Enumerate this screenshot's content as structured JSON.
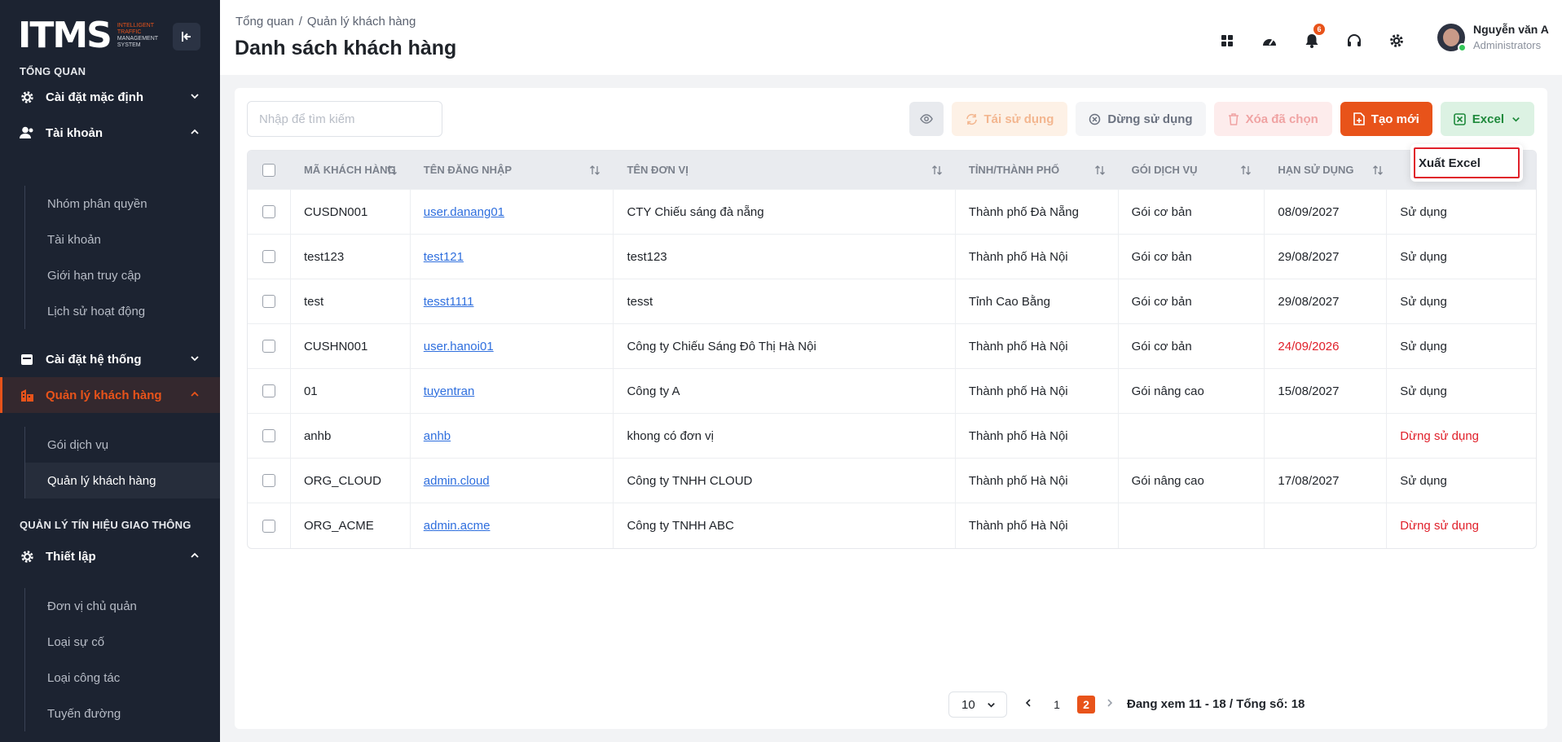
{
  "brand": {
    "logo": "ITMS",
    "tagline": [
      "INTELLIGENT",
      "TRAFFIC",
      "MANAGEMENT",
      "SYSTEM"
    ]
  },
  "sidebar": {
    "section_overview": "TỔNG QUAN",
    "default_settings": "Cài đặt mặc định",
    "account": "Tài khoản",
    "account_items": [
      "Nhóm phân quyền",
      "Tài khoản",
      "Giới hạn truy cập",
      "Lịch sử hoạt động"
    ],
    "system_settings": "Cài đặt hệ thống",
    "customer_mgmt": "Quản lý khách hàng",
    "customer_items": [
      "Gói dịch vụ",
      "Quản lý khách hàng"
    ],
    "section_traffic": "QUẢN LÝ TÍN HIỆU GIAO THÔNG",
    "setup": "Thiết lập",
    "setup_items": [
      "Đơn vị chủ quản",
      "Loại sự cố",
      "Loại công tác",
      "Tuyến đường"
    ]
  },
  "header": {
    "breadcrumb": [
      "Tổng quan",
      "Quản lý khách hàng"
    ],
    "title": "Danh sách khách hàng",
    "notification_count": "6",
    "user_name": "Nguyễn văn A",
    "user_role": "Administrators"
  },
  "toolbar": {
    "search_placeholder": "Nhập để tìm kiếm",
    "reuse": "Tái sử dụng",
    "stop": "Dừng sử dụng",
    "delete_selected": "Xóa đã chọn",
    "create": "Tạo mới",
    "excel": "Excel",
    "export_excel": "Xuất Excel"
  },
  "table": {
    "headers": [
      "MÃ KHÁCH HÀNG",
      "TÊN ĐĂNG NHẬP",
      "TÊN ĐƠN VỊ",
      "TỈNH/THÀNH PHỐ",
      "GÓI DỊCH VỤ",
      "HẠN SỬ DỤNG"
    ],
    "rows": [
      {
        "code": "CUSDN001",
        "username": "user.danang01",
        "unit": "CTY Chiếu sáng đà nẵng",
        "city": "Thành phố Đà Nẵng",
        "plan": "Gói cơ bản",
        "expiry": "08/09/2027",
        "expiry_warn": false,
        "status": "Sử dụng",
        "status_stopped": false
      },
      {
        "code": "test123",
        "username": "test121",
        "unit": "test123",
        "city": "Thành phố Hà Nội",
        "plan": "Gói cơ bản",
        "expiry": "29/08/2027",
        "expiry_warn": false,
        "status": "Sử dụng",
        "status_stopped": false
      },
      {
        "code": "test",
        "username": "tesst1111",
        "unit": "tesst",
        "city": "Tỉnh Cao Bằng",
        "plan": "Gói cơ bản",
        "expiry": "29/08/2027",
        "expiry_warn": false,
        "status": "Sử dụng",
        "status_stopped": false
      },
      {
        "code": "CUSHN001",
        "username": "user.hanoi01",
        "unit": "Công ty Chiếu Sáng Đô Thị Hà Nội",
        "city": "Thành phố Hà Nội",
        "plan": "Gói cơ bản",
        "expiry": "24/09/2026",
        "expiry_warn": true,
        "status": "Sử dụng",
        "status_stopped": false
      },
      {
        "code": "01",
        "username": "tuyentran",
        "unit": "Công ty A",
        "city": "Thành phố Hà Nội",
        "plan": "Gói nâng cao",
        "expiry": "15/08/2027",
        "expiry_warn": false,
        "status": "Sử dụng",
        "status_stopped": false
      },
      {
        "code": "anhb",
        "username": "anhb",
        "unit": "khong có đơn vị",
        "city": "Thành phố Hà Nội",
        "plan": "",
        "expiry": "",
        "expiry_warn": false,
        "status": "Dừng sử dụng",
        "status_stopped": true
      },
      {
        "code": "ORG_CLOUD",
        "username": "admin.cloud",
        "unit": "Công ty TNHH CLOUD",
        "city": "Thành phố Hà Nội",
        "plan": "Gói nâng cao",
        "expiry": "17/08/2027",
        "expiry_warn": false,
        "status": "Sử dụng",
        "status_stopped": false
      },
      {
        "code": "ORG_ACME",
        "username": "admin.acme",
        "unit": "Công ty TNHH ABC",
        "city": "Thành phố Hà Nội",
        "plan": "",
        "expiry": "",
        "expiry_warn": false,
        "status": "Dừng sử dụng",
        "status_stopped": true
      }
    ]
  },
  "pagination": {
    "page_size": "10",
    "pages": [
      "1",
      "2"
    ],
    "current": "2",
    "info": "Đang xem 11 - 18 / Tổng số: 18"
  },
  "colors": {
    "accent": "#e8531a",
    "sidebar_bg": "#1c2331",
    "link": "#2f6fde",
    "danger": "#e0202a",
    "excel": "#1f8a3c"
  },
  "icons": [
    "collapse-sidebar-icon",
    "gear-icon",
    "user-icon",
    "calendar-icon",
    "building-icon",
    "apps-grid-icon",
    "speedometer-icon",
    "bell-icon",
    "headset-icon",
    "settings-icon",
    "eye-icon",
    "refresh-icon",
    "stop-circle-icon",
    "trash-icon",
    "file-plus-icon",
    "excel-icon",
    "chevron-down-icon",
    "sort-icon"
  ]
}
